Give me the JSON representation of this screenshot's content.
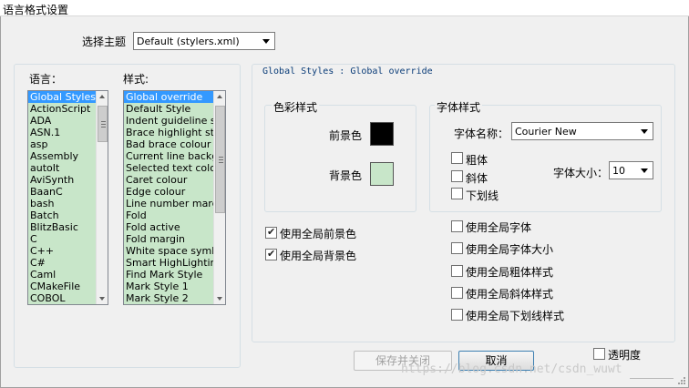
{
  "window": {
    "title": "语言格式设置"
  },
  "theme": {
    "label": "选择主题",
    "value": "Default (stylers.xml)"
  },
  "languages": {
    "label": "语言：",
    "items": [
      "Global Styles",
      "ActionScript",
      "ADA",
      "ASN.1",
      "asp",
      "Assembly",
      "autoIt",
      "AviSynth",
      "BaanC",
      "bash",
      "Batch",
      "BlitzBasic",
      "C",
      "C++",
      "C#",
      "Caml",
      "CMakeFile",
      "COBOL"
    ],
    "selected": 0
  },
  "styles": {
    "label": "样式:",
    "items": [
      "Global override",
      "Default Style",
      "Indent guideline style",
      "Brace highlight style",
      "Bad brace colour",
      "Current line background colour",
      "Selected text colour",
      "Caret colour",
      "Edge colour",
      "Line number margin",
      "Fold",
      "Fold active",
      "Fold margin",
      "White space symbol",
      "Smart HighLighting",
      "Find Mark Style",
      "Mark Style 1",
      "Mark Style 2"
    ],
    "selected": 0
  },
  "header": {
    "text": "Global Styles : Global override"
  },
  "colour_group": {
    "title": "色彩样式",
    "fg_label": "前景色",
    "bg_label": "背景色",
    "fg_color": "#000000",
    "bg_color": "#c8e6c9"
  },
  "font_group": {
    "title": "字体样式",
    "name_label": "字体名称：",
    "name_value": "Courier New",
    "size_label": "字体大小：",
    "size_value": "10",
    "bold": "粗体",
    "italic": "斜体",
    "underline": "下划线"
  },
  "global_checks": {
    "use_global_fg": "使用全局前景色",
    "use_global_bg": "使用全局背景色",
    "use_global_font": "使用全局字体",
    "use_global_font_size": "使用全局字体大小",
    "use_global_bold": "使用全局粗体样式",
    "use_global_italic": "使用全局斜体样式",
    "use_global_underline": "使用全局下划线样式"
  },
  "buttons": {
    "save_close": "保存并关闭",
    "cancel": "取消"
  },
  "transparency": {
    "label": "透明度"
  },
  "watermark": "https://blog.csdn.net/csdn_wuwt"
}
